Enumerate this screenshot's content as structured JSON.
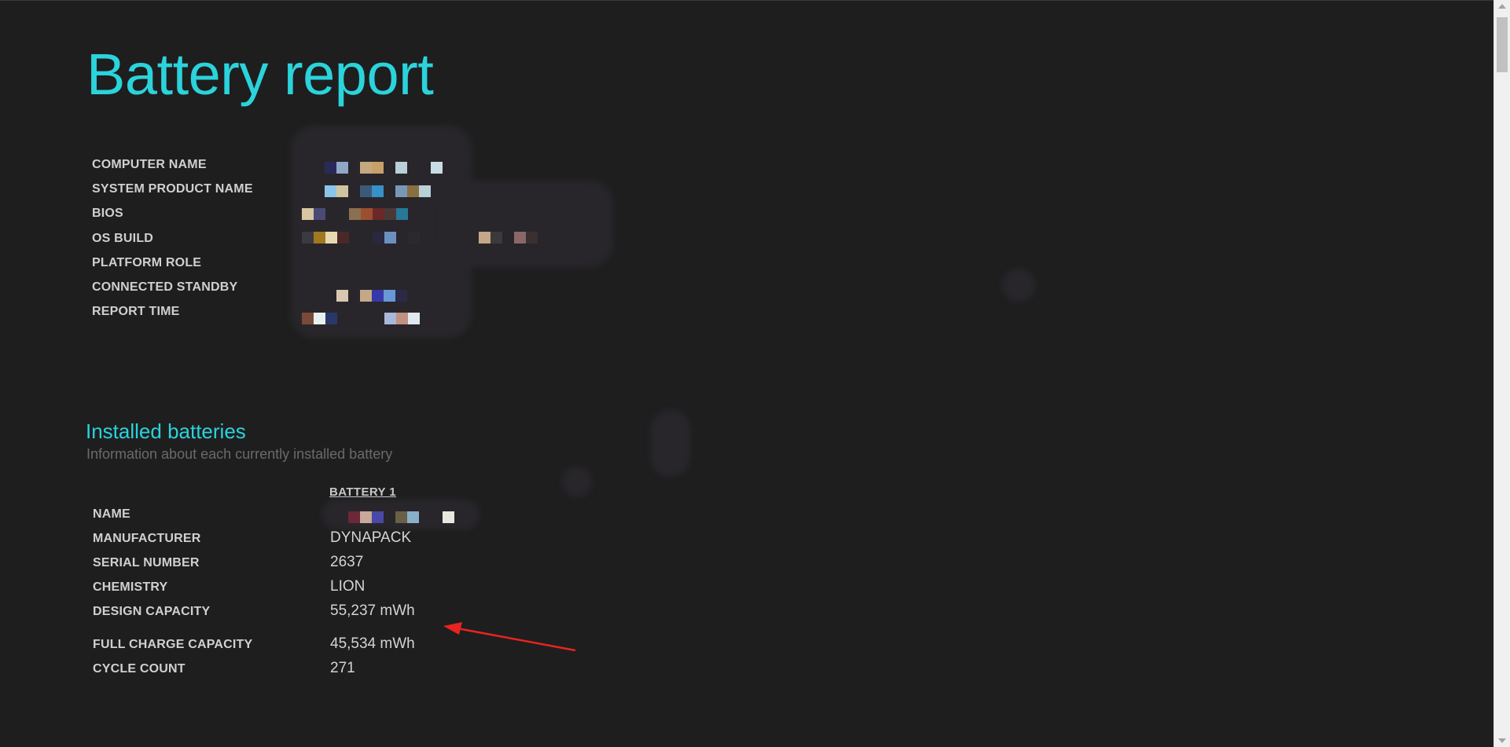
{
  "report": {
    "title": "Battery report"
  },
  "system_info": {
    "rows": [
      {
        "label": "COMPUTER NAME"
      },
      {
        "label": "SYSTEM PRODUCT NAME"
      },
      {
        "label": "BIOS"
      },
      {
        "label": "OS BUILD"
      },
      {
        "label": "PLATFORM ROLE"
      },
      {
        "label": "CONNECTED STANDBY"
      },
      {
        "label": "REPORT TIME"
      }
    ]
  },
  "installed_batteries": {
    "title": "Installed batteries",
    "subtitle": "Information about each currently installed battery",
    "battery_header": "BATTERY 1",
    "rows": [
      {
        "label": "NAME",
        "value": ""
      },
      {
        "label": "MANUFACTURER",
        "value": "DYNAPACK"
      },
      {
        "label": "SERIAL NUMBER",
        "value": "2637"
      },
      {
        "label": "CHEMISTRY",
        "value": "LION"
      },
      {
        "label": "DESIGN CAPACITY",
        "value": "55,237 mWh"
      },
      {
        "label": "FULL CHARGE CAPACITY",
        "value": "45,534 mWh"
      },
      {
        "label": "CYCLE COUNT",
        "value": "271"
      }
    ]
  },
  "colors": {
    "accent": "#2bd3db",
    "background": "#1e1e1f",
    "annotation_arrow": "#e8241f"
  },
  "annotation": {
    "icon": "red-arrow-icon"
  }
}
